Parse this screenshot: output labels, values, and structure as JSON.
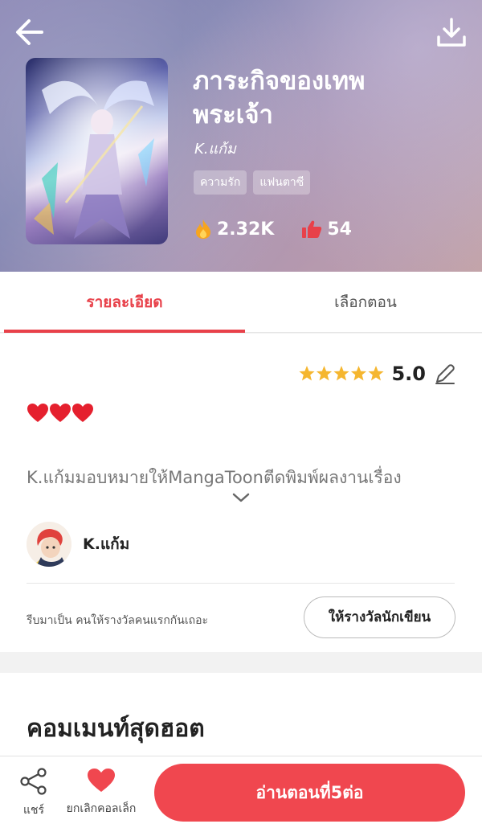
{
  "book": {
    "title": "ภาระกิจของเทพพระเจ้า",
    "author": "K.แก้ม",
    "tags": [
      "ความรัก",
      "แฟนตาซี"
    ],
    "views": "2.32K",
    "likes": "54"
  },
  "tabs": {
    "detail": "รายละเอียด",
    "episodes": "เลือกตอน"
  },
  "detail": {
    "rating_value": "5.0",
    "stars": 5,
    "hearts": "❤️❤️❤️",
    "description": "K.แก้มมอบหมายให้MangaToonตีดพิมพ์ผลงานเรื่อง",
    "author_name": "K.แก้ม",
    "reward_text": "รีบมาเป็น คนให้รางวัลคนแรกกันเถอะ",
    "reward_button": "ให้รางวัลนักเขียน"
  },
  "comments": {
    "title": "คอมเมนท์สุดฮอต"
  },
  "bottom_bar": {
    "share_label": "แชร์",
    "fav_label": "ยกเลิกคอลเล็ก",
    "read_button": "อ่านตอนที่5ต่อ"
  },
  "colors": {
    "accent": "#f0474f",
    "tab_active": "#e8414a",
    "star": "#f5b62f"
  },
  "icons": {
    "back": "arrow-left-icon",
    "download": "download-icon",
    "views": "fire-icon",
    "likes": "thumbs-up-icon",
    "edit": "pencil-icon",
    "expand": "chevron-down-icon",
    "share": "share-icon",
    "fav": "heart-icon"
  }
}
